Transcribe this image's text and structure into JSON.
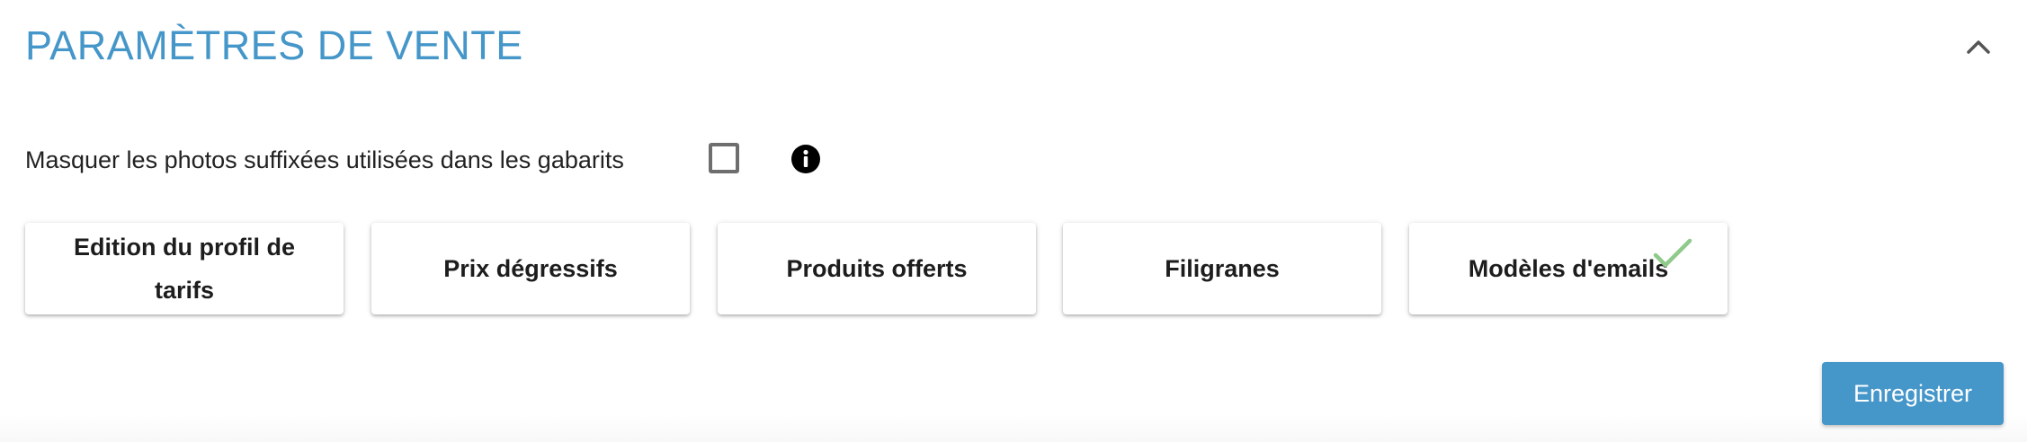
{
  "section": {
    "title": "PARAMÈTRES DE VENTE",
    "collapse_icon": "chevron-up-icon"
  },
  "option": {
    "label": "Masquer les photos suffixées utilisées dans les gabarits",
    "checked": false,
    "info_icon": "info-icon"
  },
  "cards": [
    {
      "label": "Edition du profil de tarifs",
      "completed": false
    },
    {
      "label": "Prix dégressifs",
      "completed": false
    },
    {
      "label": "Produits offerts",
      "completed": false
    },
    {
      "label": "Filigranes",
      "completed": false
    },
    {
      "label": "Modèles d'emails",
      "completed": true
    }
  ],
  "actions": {
    "save_label": "Enregistrer"
  },
  "colors": {
    "accent": "#4596c9",
    "check": "#8fca8b",
    "text": "#222222"
  }
}
